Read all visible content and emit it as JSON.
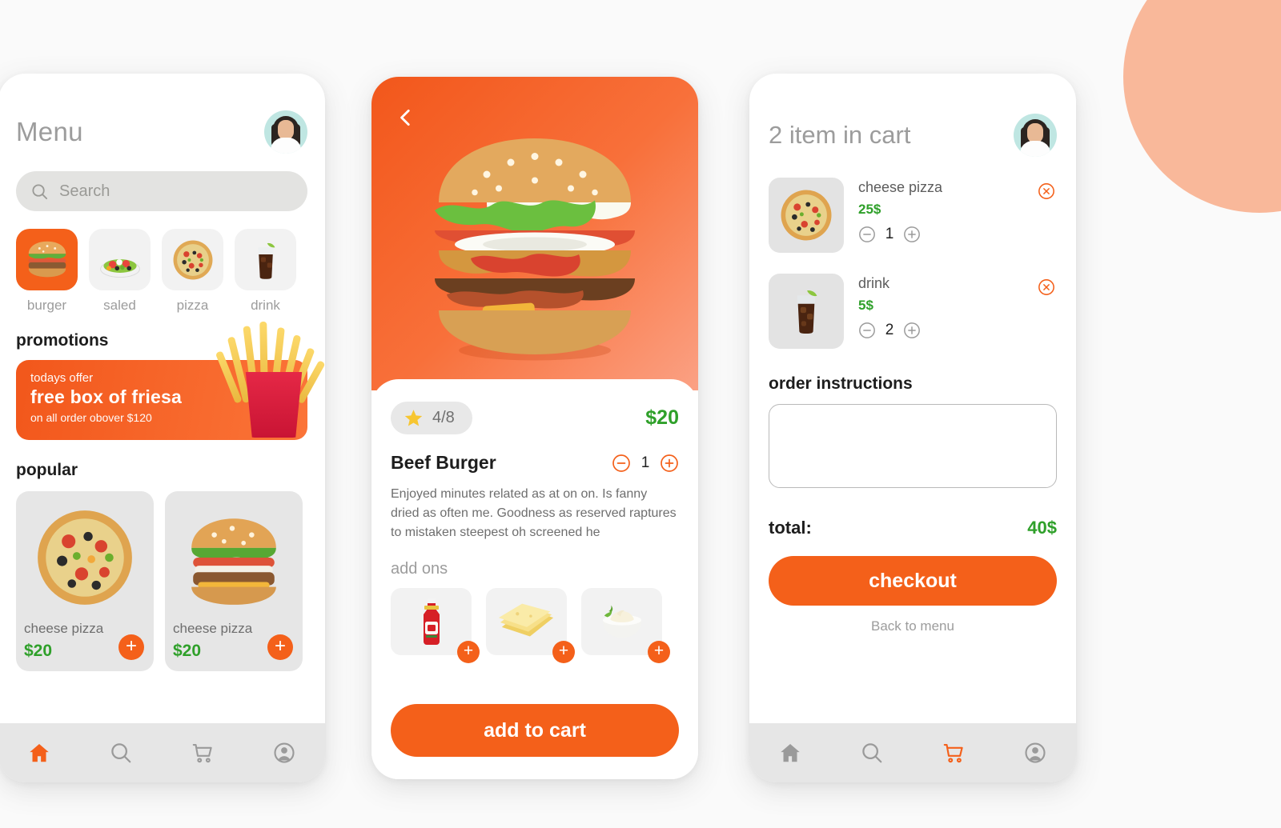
{
  "theme": {
    "orange": "#F4601A",
    "green": "#2FA02A",
    "grey_text": "#9C9C9C",
    "dark_text": "#1D1D1D",
    "deco_circle": "#F9B89A",
    "page_bg": "#FAFAFA"
  },
  "menu_screen": {
    "title": "Menu",
    "avatar_name": "avatar",
    "search": {
      "placeholder": "Search",
      "value": "",
      "icon": "search-icon"
    },
    "categories": [
      {
        "label": "burger",
        "icon": "burger-icon",
        "active": true
      },
      {
        "label": "saled",
        "icon": "salad-icon",
        "active": false
      },
      {
        "label": "pizza",
        "icon": "pizza-icon",
        "active": false
      },
      {
        "label": "drink",
        "icon": "drink-icon",
        "active": false
      }
    ],
    "promotions_title": "promotions",
    "promo": {
      "kicker": "todays offer",
      "headline": "free box of friesa",
      "subtext": "on all order obover $120",
      "image": "fries-icon"
    },
    "popular_title": "popular",
    "popular": [
      {
        "name": "cheese pizza",
        "price": "$20",
        "image": "pizza-icon",
        "add_label": "+"
      },
      {
        "name": "cheese pizza",
        "price": "$20",
        "image": "burger-icon",
        "add_label": "+"
      }
    ],
    "nav": [
      {
        "icon": "home-icon",
        "active": true
      },
      {
        "icon": "search-icon",
        "active": false
      },
      {
        "icon": "cart-icon",
        "active": false
      },
      {
        "icon": "profile-icon",
        "active": false
      }
    ]
  },
  "detail_screen": {
    "back_icon": "chevron-left-icon",
    "hero_image": "burger-hero-image",
    "rating": {
      "icon": "star-icon",
      "value": "4/8"
    },
    "price": "$20",
    "item_name": "Beef Burger",
    "quantity": "1",
    "minus_label": "minus-icon",
    "plus_label": "plus-icon",
    "description": "Enjoyed minutes related as at on on. Is fanny dried as often me. Goodness as reserved raptures to mistaken steepest oh screened he",
    "addons_title": "add ons",
    "addons": [
      {
        "name": "ketchup",
        "icon": "ketchup-bottle-icon",
        "add_label": "+"
      },
      {
        "name": "cheese",
        "icon": "cheese-slices-icon",
        "add_label": "+"
      },
      {
        "name": "mayo",
        "icon": "mayo-bowl-icon",
        "add_label": "+"
      }
    ],
    "cta_label": "add to cart"
  },
  "cart_screen": {
    "title": "2 item in cart",
    "avatar_name": "avatar",
    "items": [
      {
        "name": "cheese pizza",
        "price": "25$",
        "qty": "1",
        "image": "pizza-icon",
        "remove_icon": "close-circle-icon"
      },
      {
        "name": "drink",
        "price": "5$",
        "qty": "2",
        "image": "drink-icon",
        "remove_icon": "close-circle-icon"
      }
    ],
    "instructions_title": "order instructions",
    "instructions_value": "",
    "instructions_placeholder": "",
    "total_label": "total:",
    "total_value": "40$",
    "checkout_label": "checkout",
    "back_link": "Back to menu",
    "nav": [
      {
        "icon": "home-icon",
        "active": false
      },
      {
        "icon": "search-icon",
        "active": false
      },
      {
        "icon": "cart-icon",
        "active": true
      },
      {
        "icon": "profile-icon",
        "active": false
      }
    ]
  }
}
